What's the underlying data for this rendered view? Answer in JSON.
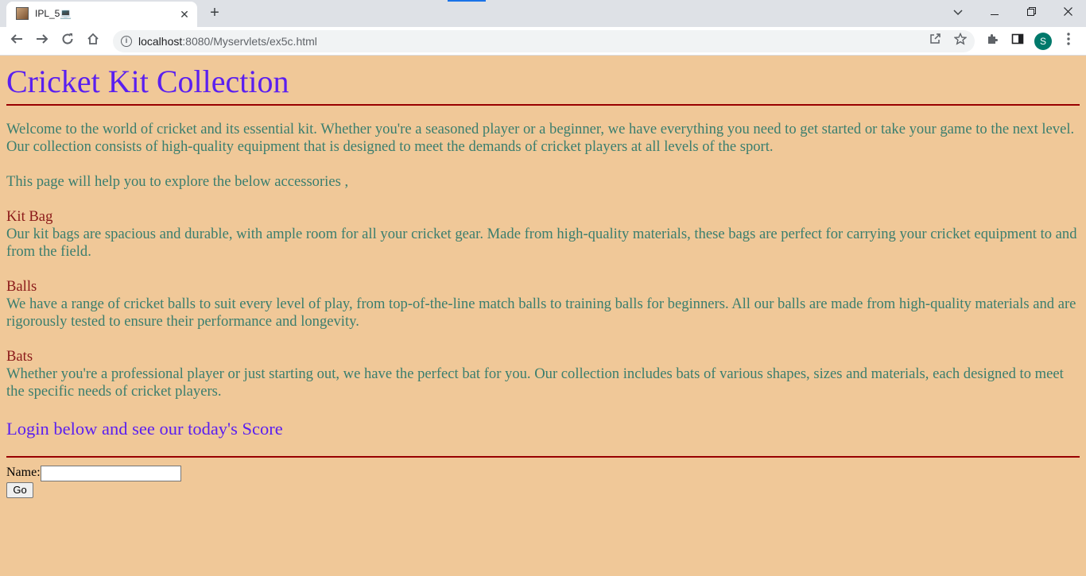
{
  "browser": {
    "tab_title": "IPL_5💻",
    "url_host": "localhost",
    "url_rest": ":8080/Myservlets/ex5c.html",
    "profile_initial": "S"
  },
  "page": {
    "title": "Cricket Kit Collection",
    "intro": "Welcome to the world of cricket and its essential kit. Whether you're a seasoned player or a beginner, we have everything you need to get started or take your game to the next level. Our collection consists of high-quality equipment that is designed to meet the demands of cricket players at all levels of the sport.",
    "explore": "This page will help you to explore the below accessories ,",
    "items": [
      {
        "heading": "Kit Bag",
        "text": "Our kit bags are spacious and durable, with ample room for all your cricket gear. Made from high-quality materials, these bags are perfect for carrying your cricket equipment to and from the field."
      },
      {
        "heading": "Balls",
        "text": "We have a range of cricket balls to suit every level of play, from top-of-the-line match balls to training balls for beginners. All our balls are made from high-quality materials and are rigorously tested to ensure their performance and longevity."
      },
      {
        "heading": "Bats",
        "text": "Whether you're a professional player or just starting out, we have the perfect bat for you. Our collection includes bats of various shapes, sizes and materials, each designed to meet the specific needs of cricket players."
      }
    ],
    "login_heading": "Login below and see our today's Score",
    "form": {
      "name_label": "Name:",
      "name_value": "",
      "go_label": "Go"
    }
  },
  "colors": {
    "background": "#f0c898",
    "title": "#5a1ff0",
    "body_text": "#3a7e6e",
    "item_heading": "#8b1a1a",
    "rule": "#990000"
  }
}
